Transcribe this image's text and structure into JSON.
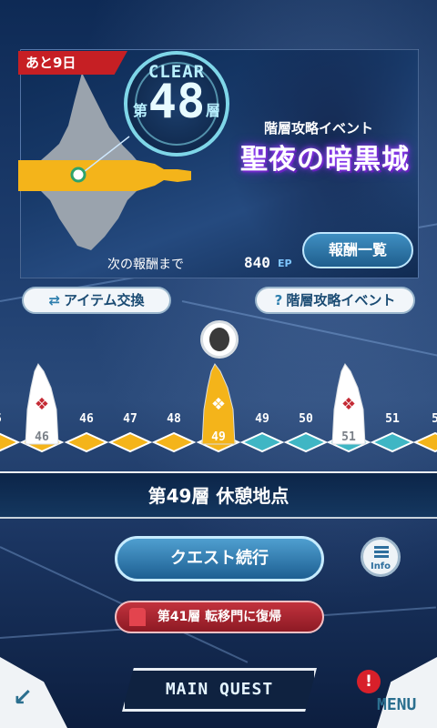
{
  "banner": {
    "days_left": "あと9日",
    "clear_label": "CLEAR",
    "floor_prefix": "第",
    "floor_number": "48",
    "floor_suffix": "層",
    "event_subtitle": "階層攻略イベント",
    "event_title": "聖夜の暗黒城",
    "next_reward_label": "次の報酬まで",
    "ep_value": "840",
    "ep_unit": "EP",
    "reward_list_button": "報酬一覧"
  },
  "actions": {
    "item_exchange": "アイテム交換",
    "item_exchange_icon": "exchange-arrows-icon",
    "event_help": "階層攻略イベント",
    "event_help_icon": "question-icon"
  },
  "floors": [
    {
      "label": "5",
      "state": "partial-left",
      "kind": "normal"
    },
    {
      "label": "46",
      "state": "cleared",
      "kind": "boss"
    },
    {
      "label": "46",
      "state": "cleared",
      "kind": "normal"
    },
    {
      "label": "47",
      "state": "cleared",
      "kind": "normal"
    },
    {
      "label": "48",
      "state": "cleared",
      "kind": "normal"
    },
    {
      "label": "49",
      "state": "current",
      "kind": "boss"
    },
    {
      "label": "49",
      "state": "locked",
      "kind": "normal"
    },
    {
      "label": "50",
      "state": "locked",
      "kind": "normal"
    },
    {
      "label": "51",
      "state": "locked",
      "kind": "boss"
    },
    {
      "label": "51",
      "state": "locked",
      "kind": "normal"
    },
    {
      "label": "5",
      "state": "partial-right",
      "kind": "normal"
    }
  ],
  "location": {
    "text": "第49層 休憩地点"
  },
  "buttons": {
    "continue_quest": "クエスト続行",
    "info_label": "Info",
    "return_gate": "第41層 転移門に復帰"
  },
  "bottom_nav": {
    "main_quest": "MAIN QUEST",
    "menu": "MENU",
    "alert_mark": "!",
    "back_icon": "back-arrow-icon"
  },
  "colors": {
    "cleared": "#f4b41a",
    "locked": "#3fb6c4",
    "boss_mark": "#c42a34",
    "accent": "#7fd6e8"
  }
}
